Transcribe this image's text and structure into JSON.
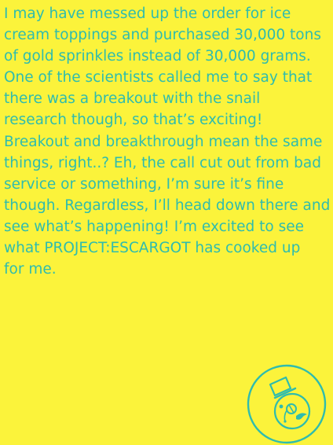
{
  "note": {
    "text": "I may have messed up the order for ice\ncream toppings and purchased 30,000 tons\nof gold sprinkles instead of 30,000 grams.\nOne of the scientists called me to say that\nthere was a breakout with the snail\nresearch though, so that’s exciting!\nBreakout and breakthrough mean the same\nthings, right..? Eh, the call cut out from bad\nservice or something, I’m sure it’s fine\nthough. Regardless, I’ll head down there and\nsee what’s happening! I’m excited to see\nwhat PROJECT:ESCARGOT has cooked up\nfor me."
  },
  "emblem": {
    "icon": "top-hat-monocle-snail-logo-icon"
  },
  "colors": {
    "background": "#fbf33b",
    "text": "#2fbcae",
    "emblem": "#2fbcae"
  }
}
